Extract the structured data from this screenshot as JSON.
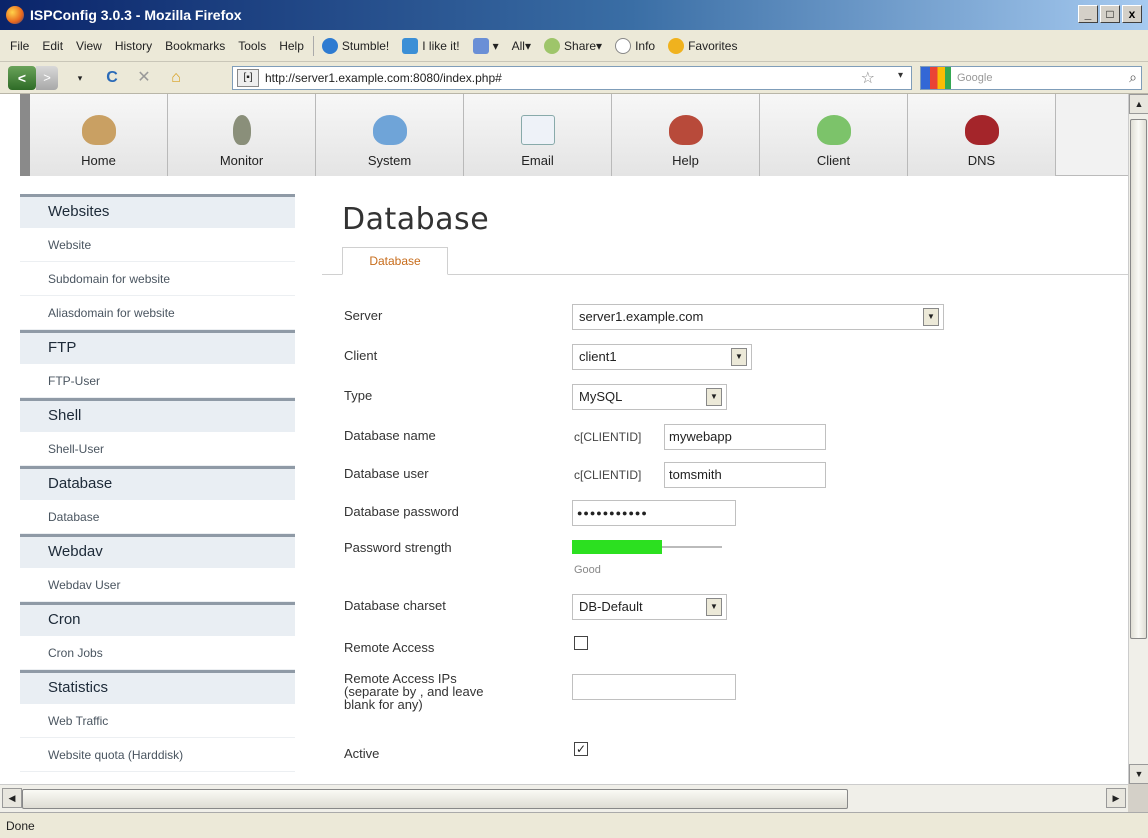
{
  "window": {
    "title": "ISPConfig 3.0.3 - Mozilla Firefox",
    "min": "_",
    "max": "□",
    "close": "x"
  },
  "menubar": {
    "items": [
      "File",
      "Edit",
      "View",
      "History",
      "Bookmarks",
      "Tools",
      "Help"
    ],
    "stumble": "Stumble!",
    "like": "I like it!",
    "all": "All",
    "share": "Share",
    "info": "Info",
    "favorites": "Favorites"
  },
  "navbar": {
    "url": "http://server1.example.com:8080/index.php#",
    "search_placeholder": "Google"
  },
  "modules": [
    "Home",
    "Monitor",
    "System",
    "Email",
    "Help",
    "Client",
    "DNS"
  ],
  "sidebar": {
    "sections": [
      {
        "title": "Websites",
        "items": [
          "Website",
          "Subdomain for website",
          "Aliasdomain for website"
        ]
      },
      {
        "title": "FTP",
        "items": [
          "FTP-User"
        ]
      },
      {
        "title": "Shell",
        "items": [
          "Shell-User"
        ]
      },
      {
        "title": "Database",
        "items": [
          "Database"
        ]
      },
      {
        "title": "Webdav",
        "items": [
          "Webdav User"
        ]
      },
      {
        "title": "Cron",
        "items": [
          "Cron Jobs"
        ]
      },
      {
        "title": "Statistics",
        "items": [
          "Web Traffic",
          "Website quota (Harddisk)"
        ]
      }
    ]
  },
  "main": {
    "title": "Database",
    "tab": "Database",
    "form": {
      "server_label": "Server",
      "server_value": "server1.example.com",
      "client_label": "Client",
      "client_value": "client1",
      "type_label": "Type",
      "type_value": "MySQL",
      "dbname_label": "Database name",
      "dbname_prefix": "c[CLIENTID]",
      "dbname_value": "mywebapp",
      "dbuser_label": "Database user",
      "dbuser_prefix": "c[CLIENTID]",
      "dbuser_value": "tomsmith",
      "dbpass_label": "Database password",
      "dbpass_value": "●●●●●●●●●●●",
      "strength_label": "Password strength",
      "strength_value": "Good",
      "strength_level": 0.6,
      "charset_label": "Database charset",
      "charset_value": "DB-Default",
      "remote_label": "Remote Access",
      "remote_checked": false,
      "remote_ips_label_1": "Remote Access IPs",
      "remote_ips_label_2": "(separate by , and leave",
      "remote_ips_label_3": "blank for any)",
      "active_label": "Active",
      "active_checked": true
    }
  },
  "status": {
    "text": "Done"
  }
}
